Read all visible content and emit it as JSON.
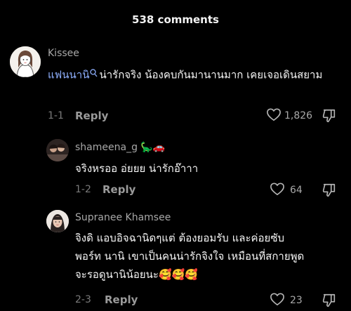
{
  "header": {
    "title": "538 comments"
  },
  "comments": [
    {
      "username": "Kissee",
      "mention": "แฟนนานิ",
      "text": "น่ารักจริง น้องคบกันมานานมาก เคยเจอเดินสยาม",
      "date": "1-1",
      "reply_label": "Reply",
      "likes": "1,826"
    },
    {
      "username": "shameena_g",
      "username_emojis": "🦕🚗",
      "text": "จริงหรออ อ่ยยย น่ารักอ๊าาา",
      "date": "1-2",
      "reply_label": "Reply",
      "likes": "64"
    },
    {
      "username": "Supranee Khamsee",
      "text_line1": "จิงดิ แอบอิจฉานิดๆแต่ ต้องยอมรับ และค่อยซับ",
      "text_line2": "พอร์ท นานิ เขาเป็นคนน่ารักจิงใจ เหมือนที่สกายพูด",
      "text_line3": "จะรอดูนานิน้อยนะ",
      "emojis": "🥰🥰🥰",
      "date": "2-3",
      "reply_label": "Reply",
      "likes": "23"
    }
  ],
  "colors": {
    "background": "#000000",
    "mention": "#8fb0ff",
    "muted": "#a8a8a8"
  }
}
